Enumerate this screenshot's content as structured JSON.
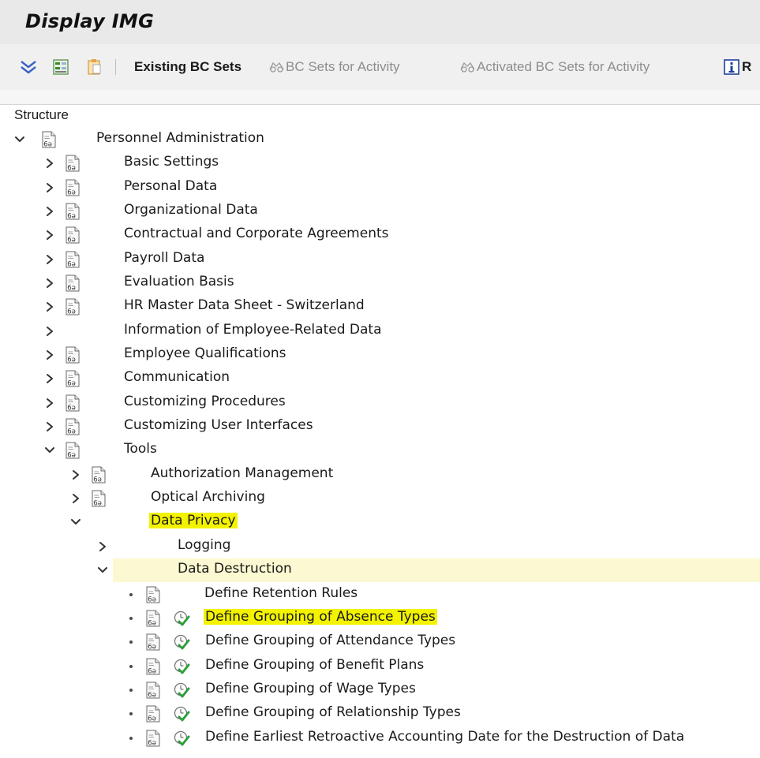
{
  "window": {
    "title": "Display IMG"
  },
  "toolbar": {
    "existing_bc_sets": "Existing BC Sets",
    "bc_sets_for_activity": "BC Sets for Activity",
    "activated_bc_sets_for_activity": "Activated BC Sets for Activity",
    "info_partial": "R"
  },
  "structure": {
    "header": "Structure"
  },
  "tree": {
    "root": "Personnel Administration",
    "items": [
      "Basic Settings",
      "Personal Data",
      "Organizational Data",
      "Contractual and Corporate Agreements",
      "Payroll Data",
      "Evaluation Basis",
      "HR Master Data Sheet - Switzerland",
      "Information of Employee-Related Data",
      "Employee Qualifications",
      "Communication",
      "Customizing Procedures",
      "Customizing User Interfaces",
      "Tools"
    ],
    "tools_children": [
      "Authorization Management",
      "Optical Archiving",
      "Data Privacy"
    ],
    "data_privacy_children": [
      "Logging",
      "Data Destruction"
    ],
    "data_destruction_children": [
      "Define Retention Rules",
      "Define Grouping of Absence Types",
      "Define Grouping of Attendance Types",
      "Define Grouping of Benefit Plans",
      "Define Grouping of Wage Types",
      "Define Grouping of Relationship Types",
      "Define Earliest Retroactive Accounting Date for the Destruction of Data"
    ]
  },
  "colors": {
    "highlight": "#f3f300",
    "selected_row": "#fbf8d2",
    "title_bar": "#e9e9e9",
    "toolbar": "#f0f0f0"
  }
}
